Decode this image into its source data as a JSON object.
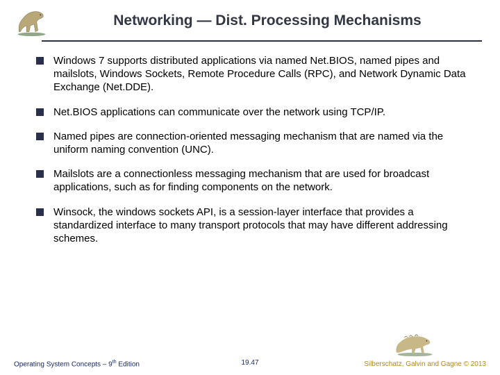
{
  "title": "Networking —  Dist. Processing Mechanisms",
  "bullets": [
    "Windows 7 supports distributed applications via named Net.BIOS, named pipes and mailslots, Windows Sockets, Remote Procedure Calls (RPC), and Network Dynamic Data Exchange (Net.DDE).",
    "Net.BIOS applications can communicate over the network using TCP/IP.",
    "Named pipes are connection-oriented messaging mechanism that are named via the uniform naming convention (UNC).",
    "Mailslots are a connectionless messaging mechanism that are used for broadcast applications, such as for finding components on the network.",
    "Winsock, the windows sockets API, is a session-layer interface that provides a standardized interface to many transport protocols that may have different addressing schemes."
  ],
  "footer": {
    "left_a": "Operating System Concepts – 9",
    "left_b": " Edition",
    "sup": "th",
    "center": "19.47",
    "right": "Silberschatz, Galvin and Gagne © 2013"
  }
}
